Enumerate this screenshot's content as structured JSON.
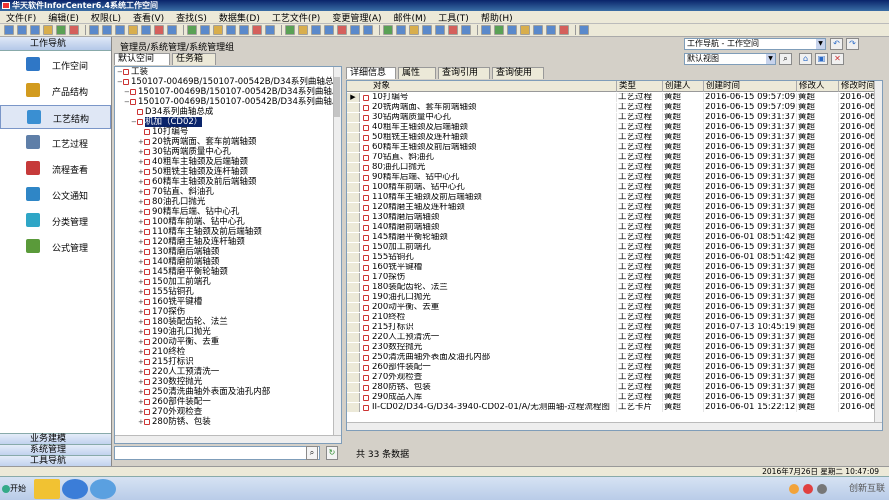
{
  "window": {
    "title": "华天软件InforCenter6.4系统工作空间"
  },
  "menu": [
    "文件(F)",
    "编辑(E)",
    "权限(L)",
    "查看(V)",
    "查找(S)",
    "数据集(D)",
    "工艺文件(P)",
    "变更管理(A)",
    "邮件(M)",
    "工具(T)",
    "帮助(H)"
  ],
  "leftnav": {
    "header": "工作导航",
    "items": [
      {
        "label": "工作空间",
        "color": "#2f77c6"
      },
      {
        "label": "产品结构",
        "color": "#d29b1f"
      },
      {
        "label": "工艺结构",
        "color": "#3a8fd2"
      },
      {
        "label": "工艺过程",
        "color": "#5f7fa8"
      },
      {
        "label": "流程查看",
        "color": "#c63a3a"
      },
      {
        "label": "公文通知",
        "color": "#2f86c6"
      },
      {
        "label": "分类管理",
        "color": "#2fa6c6"
      },
      {
        "label": "公式管理",
        "color": "#5a9a3a"
      }
    ],
    "footer": [
      "业务建模",
      "系统管理",
      "工具导航"
    ]
  },
  "breadcrumb": "管理员/系统管理/系统管理组",
  "nav_combo": "工作导航 - 工作空间",
  "view_combo": "默认视图",
  "left_tabs": [
    "默认空间",
    "任务箱"
  ],
  "tree": [
    {
      "level": 0,
      "expander": "⊟",
      "text": "工装"
    },
    {
      "level": 0,
      "expander": "⊟",
      "text": "150107-00469B/150107-00542B/D34系列曲轴总成"
    },
    {
      "level": 1,
      "expander": "⊟",
      "text": "150107-00469B/150107-00542B/D34系列曲轴总成"
    },
    {
      "level": 1,
      "expander": "⊟",
      "text": "150107-00469B/150107-00542B/D34系列曲轴总成"
    },
    {
      "level": 2,
      "expander": "",
      "text": "D34系列曲轴总成"
    },
    {
      "level": 2,
      "expander": "⊟",
      "text": "机加（CD02）",
      "selected": true
    },
    {
      "level": 3,
      "expander": "",
      "text": "10打编号"
    },
    {
      "level": 3,
      "expander": "⊞",
      "text": "20铣两端面、套车前端轴颈"
    },
    {
      "level": 3,
      "expander": "⊞",
      "text": "30钻两端质量中心孔"
    },
    {
      "level": 3,
      "expander": "⊞",
      "text": "40粗车主轴颈及后端轴颈"
    },
    {
      "level": 3,
      "expander": "⊞",
      "text": "50粗铣主轴颈及连杆轴颈"
    },
    {
      "level": 3,
      "expander": "⊞",
      "text": "60精车主轴颈及前后端轴颈"
    },
    {
      "level": 3,
      "expander": "⊞",
      "text": "70钻直、斜油孔"
    },
    {
      "level": 3,
      "expander": "⊞",
      "text": "80油孔口抛光"
    },
    {
      "level": 3,
      "expander": "⊞",
      "text": "90精车后端、钻中心孔"
    },
    {
      "level": 3,
      "expander": "⊞",
      "text": "100精车前端、钻中心孔"
    },
    {
      "level": 3,
      "expander": "⊞",
      "text": "110精车主轴颈及前后端轴颈"
    },
    {
      "level": 3,
      "expander": "⊞",
      "text": "120精磨主轴及连杆轴颈"
    },
    {
      "level": 3,
      "expander": "⊞",
      "text": "130精磨后端轴颈"
    },
    {
      "level": 3,
      "expander": "⊞",
      "text": "140精磨前端轴颈"
    },
    {
      "level": 3,
      "expander": "⊞",
      "text": "145精磨平衡轮轴颈"
    },
    {
      "level": 3,
      "expander": "⊞",
      "text": "150加工前端孔"
    },
    {
      "level": 3,
      "expander": "⊞",
      "text": "155钻铜孔"
    },
    {
      "level": 3,
      "expander": "⊞",
      "text": "160铣平键槽"
    },
    {
      "level": 3,
      "expander": "⊞",
      "text": "170探伤"
    },
    {
      "level": 3,
      "expander": "⊞",
      "text": "180装配齿轮、法兰"
    },
    {
      "level": 3,
      "expander": "⊞",
      "text": "190油孔口抛光"
    },
    {
      "level": 3,
      "expander": "⊞",
      "text": "200动平衡、去重"
    },
    {
      "level": 3,
      "expander": "⊞",
      "text": "210终检"
    },
    {
      "level": 3,
      "expander": "⊞",
      "text": "215打标识"
    },
    {
      "level": 3,
      "expander": "⊞",
      "text": "220人工预清洗一"
    },
    {
      "level": 3,
      "expander": "⊞",
      "text": "230数控抛光"
    },
    {
      "level": 3,
      "expander": "⊞",
      "text": "250清洗曲轴外表面及油孔内部"
    },
    {
      "level": 3,
      "expander": "⊞",
      "text": "260部件装配一"
    },
    {
      "level": 3,
      "expander": "⊞",
      "text": "270外观检查"
    },
    {
      "level": 3,
      "expander": "⊞",
      "text": "280防锈、包装"
    }
  ],
  "right_tabs": [
    "详细信息",
    "属性",
    "查询引用",
    "查询使用"
  ],
  "grid": {
    "columns": [
      "对象",
      "类型",
      "创建人",
      "创建时间",
      "修改人",
      "修改时间"
    ],
    "rows": [
      [
        "10打编号",
        "工艺过程",
        "黄超",
        "2016-06-15 09:57:09",
        "黄超",
        "2016-06"
      ],
      [
        "20铣两端面、套车前端轴颈",
        "工艺过程",
        "黄超",
        "2016-06-15 09:57:09",
        "黄超",
        "2016-06"
      ],
      [
        "30钻两端质量中心孔",
        "工艺过程",
        "黄超",
        "2016-06-15 09:31:37",
        "黄超",
        "2016-06"
      ],
      [
        "40粗车主轴颈及后端轴颈",
        "工艺过程",
        "黄超",
        "2016-06-15 09:31:37",
        "黄超",
        "2016-06"
      ],
      [
        "50粗铣主轴颈及连杆轴颈",
        "工艺过程",
        "黄超",
        "2016-06-15 09:31:37",
        "黄超",
        "2016-06"
      ],
      [
        "60精车主轴颈及前后端轴颈",
        "工艺过程",
        "黄超",
        "2016-06-15 09:31:37",
        "黄超",
        "2016-06"
      ],
      [
        "70钻直、斜油孔",
        "工艺过程",
        "黄超",
        "2016-06-15 09:31:37",
        "黄超",
        "2016-06"
      ],
      [
        "80油孔口抛光",
        "工艺过程",
        "黄超",
        "2016-06-15 09:31:37",
        "黄超",
        "2016-06"
      ],
      [
        "90精车后端、钻中心孔",
        "工艺过程",
        "黄超",
        "2016-06-15 09:31:37",
        "黄超",
        "2016-06"
      ],
      [
        "100精车前端、钻中心孔",
        "工艺过程",
        "黄超",
        "2016-06-15 09:31:37",
        "黄超",
        "2016-06"
      ],
      [
        "110精车主轴颈及前后端轴颈",
        "工艺过程",
        "黄超",
        "2016-06-15 09:31:37",
        "黄超",
        "2016-06"
      ],
      [
        "120精磨主轴及连杆轴颈",
        "工艺过程",
        "黄超",
        "2016-06-15 09:31:37",
        "黄超",
        "2016-06"
      ],
      [
        "130精磨后端轴颈",
        "工艺过程",
        "黄超",
        "2016-06-15 09:31:37",
        "黄超",
        "2016-06"
      ],
      [
        "140精磨前端轴颈",
        "工艺过程",
        "黄超",
        "2016-06-15 09:31:37",
        "黄超",
        "2016-06"
      ],
      [
        "145精磨平衡轮轴颈",
        "工艺过程",
        "黄超",
        "2016-06-01 08:51:42",
        "黄超",
        "2016-06"
      ],
      [
        "150加工前端孔",
        "工艺过程",
        "黄超",
        "2016-06-15 09:31:37",
        "黄超",
        "2016-06"
      ],
      [
        "155钻铜孔",
        "工艺过程",
        "黄超",
        "2016-06-01 08:51:42",
        "黄超",
        "2016-06"
      ],
      [
        "160铣平键槽",
        "工艺过程",
        "黄超",
        "2016-06-15 09:31:37",
        "黄超",
        "2016-06"
      ],
      [
        "170探伤",
        "工艺过程",
        "黄超",
        "2016-06-15 09:31:37",
        "黄超",
        "2016-06"
      ],
      [
        "180装配齿轮、法兰",
        "工艺过程",
        "黄超",
        "2016-06-15 09:31:37",
        "黄超",
        "2016-06"
      ],
      [
        "190油孔口抛光",
        "工艺过程",
        "黄超",
        "2016-06-15 09:31:37",
        "黄超",
        "2016-06"
      ],
      [
        "200动平衡、去重",
        "工艺过程",
        "黄超",
        "2016-06-15 09:31:37",
        "黄超",
        "2016-06"
      ],
      [
        "210终检",
        "工艺过程",
        "黄超",
        "2016-06-15 09:31:37",
        "黄超",
        "2016-06"
      ],
      [
        "215打标识",
        "工艺过程",
        "黄超",
        "2016-07-13 10:45:19",
        "黄超",
        "2016-06"
      ],
      [
        "220人工预清洗一",
        "工艺过程",
        "黄超",
        "2016-06-15 09:31:37",
        "黄超",
        "2016-06"
      ],
      [
        "230数控抛光",
        "工艺过程",
        "黄超",
        "2016-06-15 09:31:37",
        "黄超",
        "2016-06"
      ],
      [
        "250清洗曲轴外表面及油孔内部",
        "工艺过程",
        "黄超",
        "2016-06-15 09:31:37",
        "黄超",
        "2016-06"
      ],
      [
        "260部件装配一",
        "工艺过程",
        "黄超",
        "2016-06-15 09:31:37",
        "黄超",
        "2016-06"
      ],
      [
        "270外观检查",
        "工艺过程",
        "黄超",
        "2016-06-15 09:31:37",
        "黄超",
        "2016-06"
      ],
      [
        "280防锈、包装",
        "工艺过程",
        "黄超",
        "2016-06-15 09:31:37",
        "黄超",
        "2016-06"
      ],
      [
        "290成品入库",
        "工艺过程",
        "黄超",
        "2016-06-15 09:31:37",
        "黄超",
        "2016-06"
      ],
      [
        "II-CD02/D34-G/D34-3940-CD02-01/A/无测曲轴-过程流程图",
        "工艺卡片",
        "黄超",
        "2016-06-01 15:22:12",
        "黄超",
        "2016-06"
      ]
    ]
  },
  "count_text": "共 33 条数据",
  "status": {
    "datetime": "2016年7月26日 星期二 10:47:09"
  },
  "taskbar": {
    "start": "开始"
  },
  "watermark": "创新互联"
}
